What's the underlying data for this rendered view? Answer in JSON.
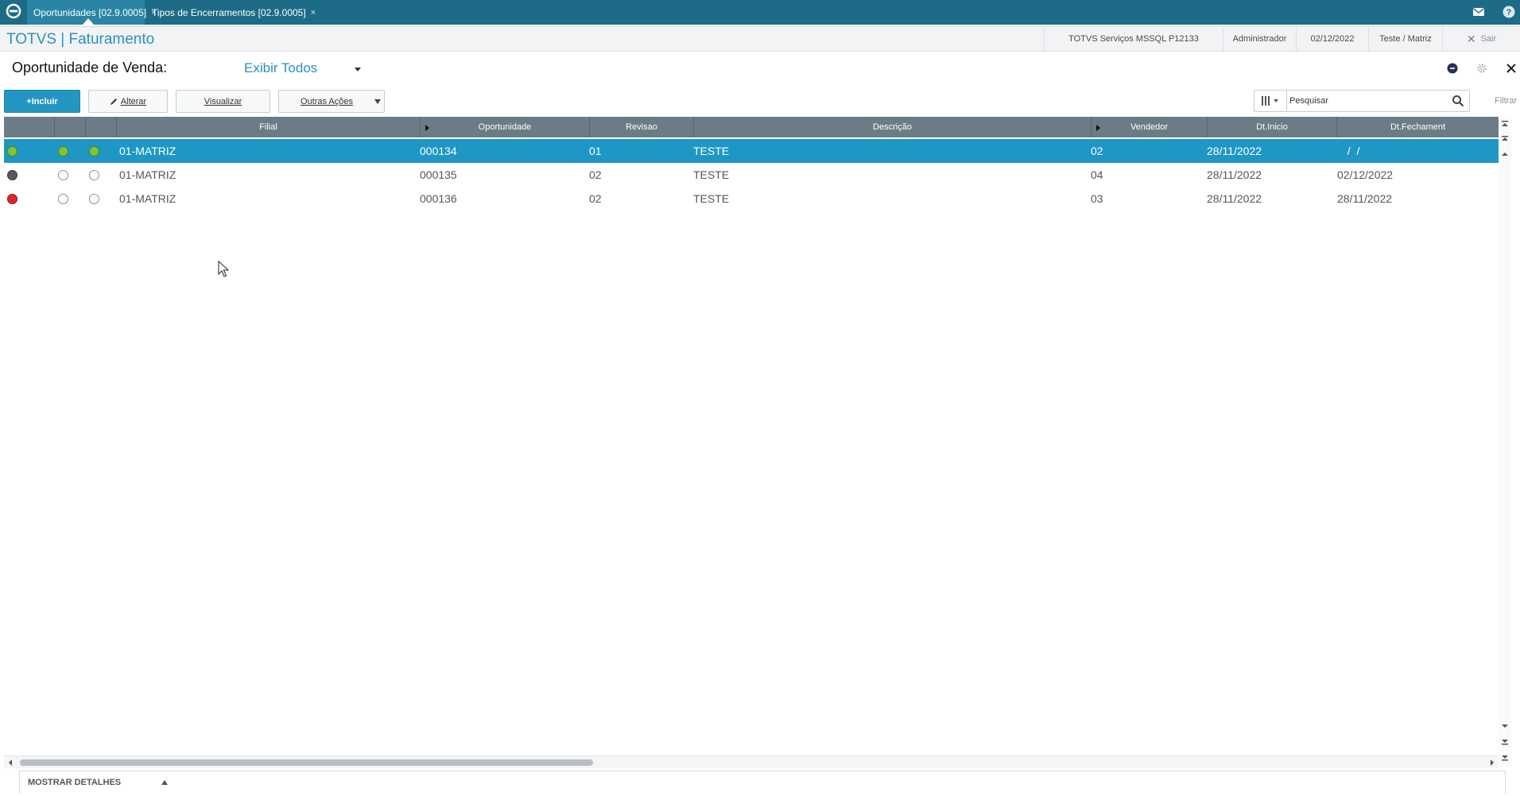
{
  "tabs": [
    {
      "label": "Oportunidades [02.9.0005]",
      "close": "×"
    },
    {
      "label": "Tipos de Encerramentos [02.9.0005]",
      "close": "×"
    }
  ],
  "header": {
    "app_title": "TOTVS | Faturamento",
    "environment": "TOTVS Serviços MSSQL P12133",
    "user": "Administrador",
    "date": "02/12/2022",
    "company": "Teste / Matriz",
    "exit_label": "Sair"
  },
  "page": {
    "title": "Oportunidade de Venda:",
    "filter_value": "Exibir Todos"
  },
  "toolbar": {
    "include_label": "+Incluir",
    "edit_label": "Alterar",
    "view_label": "Visualizar",
    "other_actions_label": "Outras Ações",
    "search_placeholder": "Pesquisar",
    "filter_label": "Filtrar"
  },
  "grid": {
    "columns": [
      "Filial",
      "Oportunidade",
      "Revisao",
      "Descrição",
      "Vendedor",
      "Dt.Inicio",
      "Dt.Fechament"
    ],
    "rows": [
      {
        "status_colors": [
          "#7ec636",
          "#7ec636",
          "#7ec636"
        ],
        "filial": "01-MATRIZ",
        "oportunidade": "000134",
        "revisao": "01",
        "descricao": "TESTE",
        "vendedor": "02",
        "dt_inicio": "28/11/2022",
        "dt_fechamento": "  /  /",
        "selected": true
      },
      {
        "status_colors": [
          "#555a5e",
          "#ffffff",
          "#ffffff"
        ],
        "filial": "01-MATRIZ",
        "oportunidade": "000135",
        "revisao": "02",
        "descricao": "TESTE",
        "vendedor": "04",
        "dt_inicio": "28/11/2022",
        "dt_fechamento": "02/12/2022",
        "selected": false
      },
      {
        "status_colors": [
          "#e0262e",
          "#ffffff",
          "#ffffff"
        ],
        "filial": "01-MATRIZ",
        "oportunidade": "000136",
        "revisao": "02",
        "descricao": "TESTE",
        "vendedor": "03",
        "dt_inicio": "28/11/2022",
        "dt_fechamento": "28/11/2022",
        "selected": false
      }
    ]
  },
  "footer": {
    "details_label": "MOSTRAR DETALHES"
  },
  "colors": {
    "tabbar": "#1d6b87",
    "accent": "#2396c2",
    "grid_header": "#6b7c86",
    "row_selected": "#1f97c5"
  }
}
